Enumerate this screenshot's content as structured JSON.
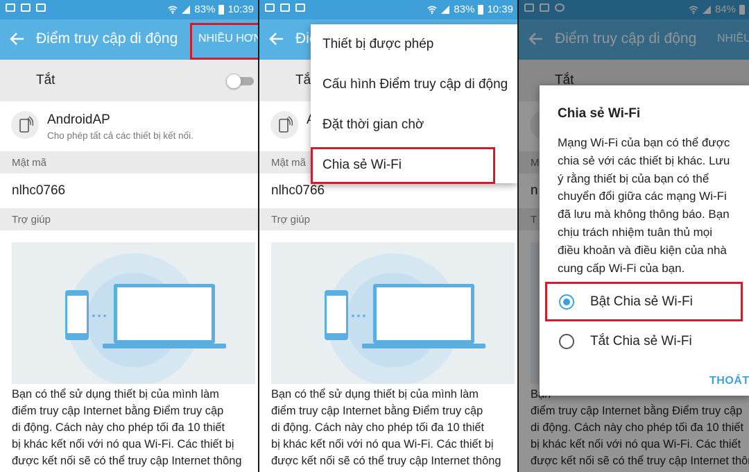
{
  "colors": {
    "status_bar": "#3f9fd8",
    "app_bar": "#58b1e3",
    "highlight": "#c8202f",
    "accent": "#3fa0dc"
  },
  "panels": [
    {
      "status": {
        "battery": "83%",
        "time": "10:39",
        "icons": [
          "gallery-icon",
          "mail-icon",
          "youtube-icon"
        ]
      },
      "app_bar": {
        "title": "Điểm truy cập di động",
        "more": "NHIỀU HƠN"
      },
      "toggle_label": "Tắt",
      "ap": {
        "name": "AndroidAP",
        "subtitle": "Cho phép tất cả các thiết bị kết nối."
      },
      "password_header": "Mật mã",
      "password": "nlhc0766",
      "help_header": "Trợ giúp",
      "help_lines": [
        "Bạn có thể sử dụng thiết bị của mình làm",
        "điểm truy cập Internet bằng Điểm truy cập",
        "di động. Cách này cho phép tối đa 10 thiết",
        "bị khác kết nối với nó qua Wi-Fi. Các thiết bị",
        "được kết nối sẽ có thể truy cập Internet thông"
      ]
    },
    {
      "status": {
        "battery": "83%",
        "time": "10:39",
        "icons": [
          "gallery-icon",
          "mail-icon",
          "youtube-icon"
        ]
      },
      "app_bar": {
        "title": "Điể"
      },
      "toggle_label": "Tắt",
      "ap": {
        "name": "A"
      },
      "password_header": "Mật mã",
      "password": "nlhc0766",
      "help_header": "Trợ giúp",
      "help_lines": [
        "Bạn có thể sử dụng thiết bị của mình làm",
        "điểm truy cập Internet bằng Điểm truy cập",
        "di động. Cách này cho phép tối đa 10 thiết",
        "bị khác kết nối với nó qua Wi-Fi. Các thiết bị",
        "được kết nối sẽ có thể truy cập Internet thông"
      ],
      "menu": [
        "Thiết bị được phép",
        "Cấu hình Điểm truy cập di động",
        "Đặt thời gian chờ",
        "Chia sẻ Wi-Fi"
      ]
    },
    {
      "status": {
        "battery": "84%",
        "icons": [
          "mail-icon",
          "mail-icon",
          "messenger-icon"
        ]
      },
      "app_bar": {
        "title": "Điểm truy cập di động",
        "more": "NHIỀU"
      },
      "toggle_label": "Tắt",
      "partial": [
        "M",
        "n",
        "T",
        "Bạn",
        "điểm truy cập Internet bằng Điểm truy cập",
        "di động. Cách này cho phép tối đa 10 thiết",
        "bị khác kết nối với nó qua Wi-Fi. Các thiết",
        "được kết nối sẽ có thể truy cập Internet thông"
      ],
      "dialog": {
        "title": "Chia sẻ Wi-Fi",
        "body_lines": [
          "Mạng Wi-Fi của bạn có thể được",
          "chia sẻ với các thiết bị khác. Lưu",
          "ý rằng thiết bị của bạn có thể",
          "chuyển đổi giữa các mạng Wi-Fi",
          "đã lưu mà không thông báo. Bạn",
          "chịu trách nhiệm tuân thủ mọi",
          "điều khoản và điều kiện của nhà",
          "cung cấp Wi-Fi của bạn."
        ],
        "option_on": "Bật Chia sẻ Wi-Fi",
        "option_off": "Tắt Chia sẻ Wi-Fi",
        "selected": "on",
        "exit": "THOÁT"
      }
    }
  ]
}
